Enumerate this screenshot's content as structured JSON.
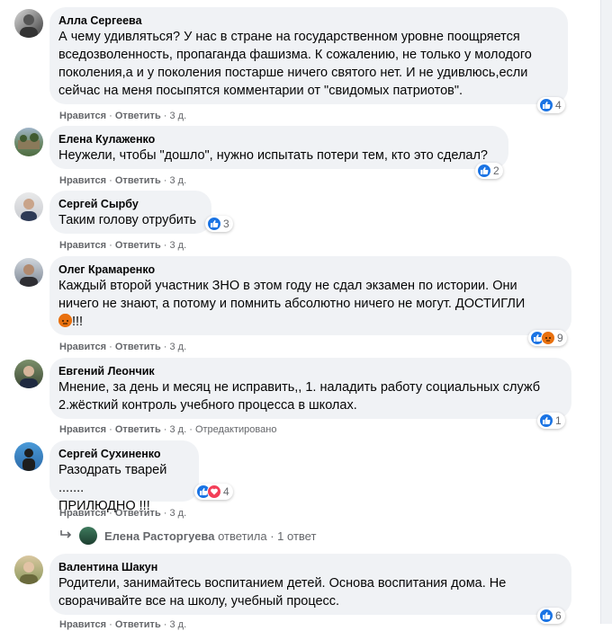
{
  "comments": [
    {
      "author": "Алла Сергеева",
      "text": "А чему удивляться? У нас в стране на государственном уровне поощряется\nвседозволенность, пропаганда фашизма. К сожалению, не только у молодого\nпоколения,а и у поколения постарше ничего святого нет. И не удивлюсь,если\nсейчас на меня посыпятся комментарии от \"свидомых патриотов\".",
      "like": "Нравится",
      "reply": "Ответить",
      "time": "3 д.",
      "edited": "",
      "reactions": "4"
    },
    {
      "author": "Елена Кулаженко",
      "text": "Неужели, чтобы \"дошло\", нужно испытать потери тем, кто это сделал?",
      "like": "Нравится",
      "reply": "Ответить",
      "time": "3 д.",
      "edited": "",
      "reactions": "2"
    },
    {
      "author": "Сергей Сырбу",
      "text": "Таким голову отрубить",
      "like": "Нравится",
      "reply": "Ответить",
      "time": "3 д.",
      "edited": "",
      "reactions": "3"
    },
    {
      "author": "Олег Крамаренко",
      "text": "Каждый второй участник ЗНО в этом году не сдал экзамен по истории. Они\nничего не знают, а потому и помнить абсолютно ничего не могут. ДОСТИГЛИ",
      "text_end": "!!!",
      "like": "Нравится",
      "reply": "Ответить",
      "time": "3 д.",
      "edited": "",
      "reactions": "9"
    },
    {
      "author": "Евгений Леончик",
      "text": "Мнение, за день и месяц не исправить,, 1. наладить работу социальных служб\n2.жёсткий контроль учебного процесса в школах.",
      "like": "Нравится",
      "reply": "Ответить",
      "time": "3 д.",
      "edited": "Отредактировано",
      "reactions": "1"
    },
    {
      "author": "Сергей Сухиненко",
      "text": "Разодрать тварей .......\nПРИЛЮДНО !!!",
      "like": "Нравится",
      "reply": "Ответить",
      "time": "3 д.",
      "edited": "",
      "reactions": "4"
    },
    {
      "author": "Валентина Шакун",
      "text": "Родители, занимайтесь воспитанием детей. Основа воспитания дома. Не\nсворачивайте все на школу, учебный процесс.",
      "like": "Нравится",
      "reply": "Ответить",
      "time": "3 д.",
      "edited": "",
      "reactions": "6"
    }
  ],
  "reply_thread": {
    "name": "Елена Расторгуева",
    "action": "ответила",
    "count": "1 ответ"
  },
  "icons": {
    "like": "thumbs-up-icon",
    "haha": "haha-icon",
    "angry": "angry-icon",
    "love": "heart-icon",
    "reply": "reply-arrow-icon"
  },
  "colors": {
    "like": "#1b74e4",
    "bubble": "#f0f2f5",
    "meta": "#65676b"
  }
}
